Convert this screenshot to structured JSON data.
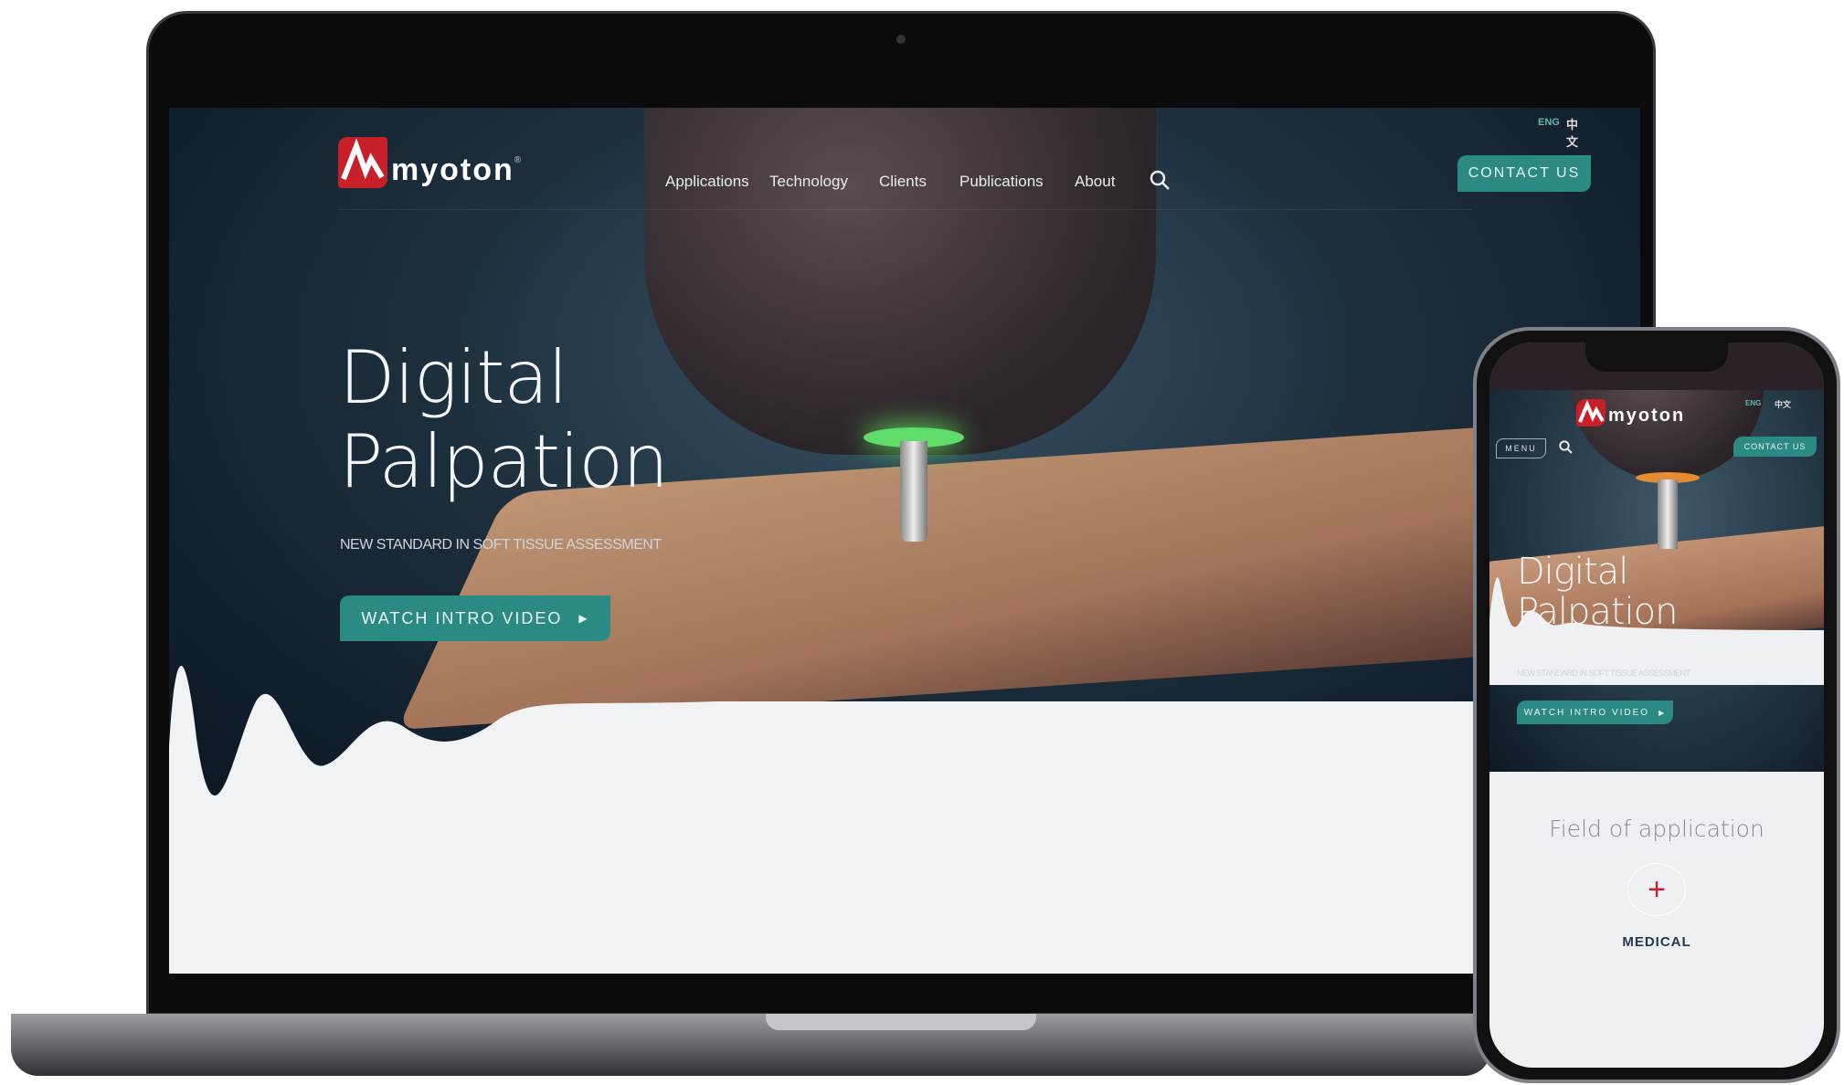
{
  "brand": {
    "name": "myoton",
    "registered": "®",
    "accent": "#2c8a84",
    "logo_red": "#c8202a"
  },
  "languages": [
    "ENG",
    "中文"
  ],
  "nav": {
    "items": [
      "Applications",
      "Technology",
      "Clients",
      "Publications",
      "About"
    ],
    "search_icon": "search-icon",
    "contact_label": "CONTACT US"
  },
  "hero": {
    "title_line1": "Digital",
    "title_line2": "Palpation",
    "subtitle": "NEW STANDARD IN SOFT TISSUE ASSESSMENT",
    "cta_label": "WATCH INTRO VIDEO",
    "cta_icon": "play-triangle-icon"
  },
  "mobile": {
    "menu_label": "MENU",
    "contact_label": "CONTACT US",
    "section_title": "Field of application",
    "category_label": "MEDICAL",
    "category_icon": "plus-icon"
  }
}
